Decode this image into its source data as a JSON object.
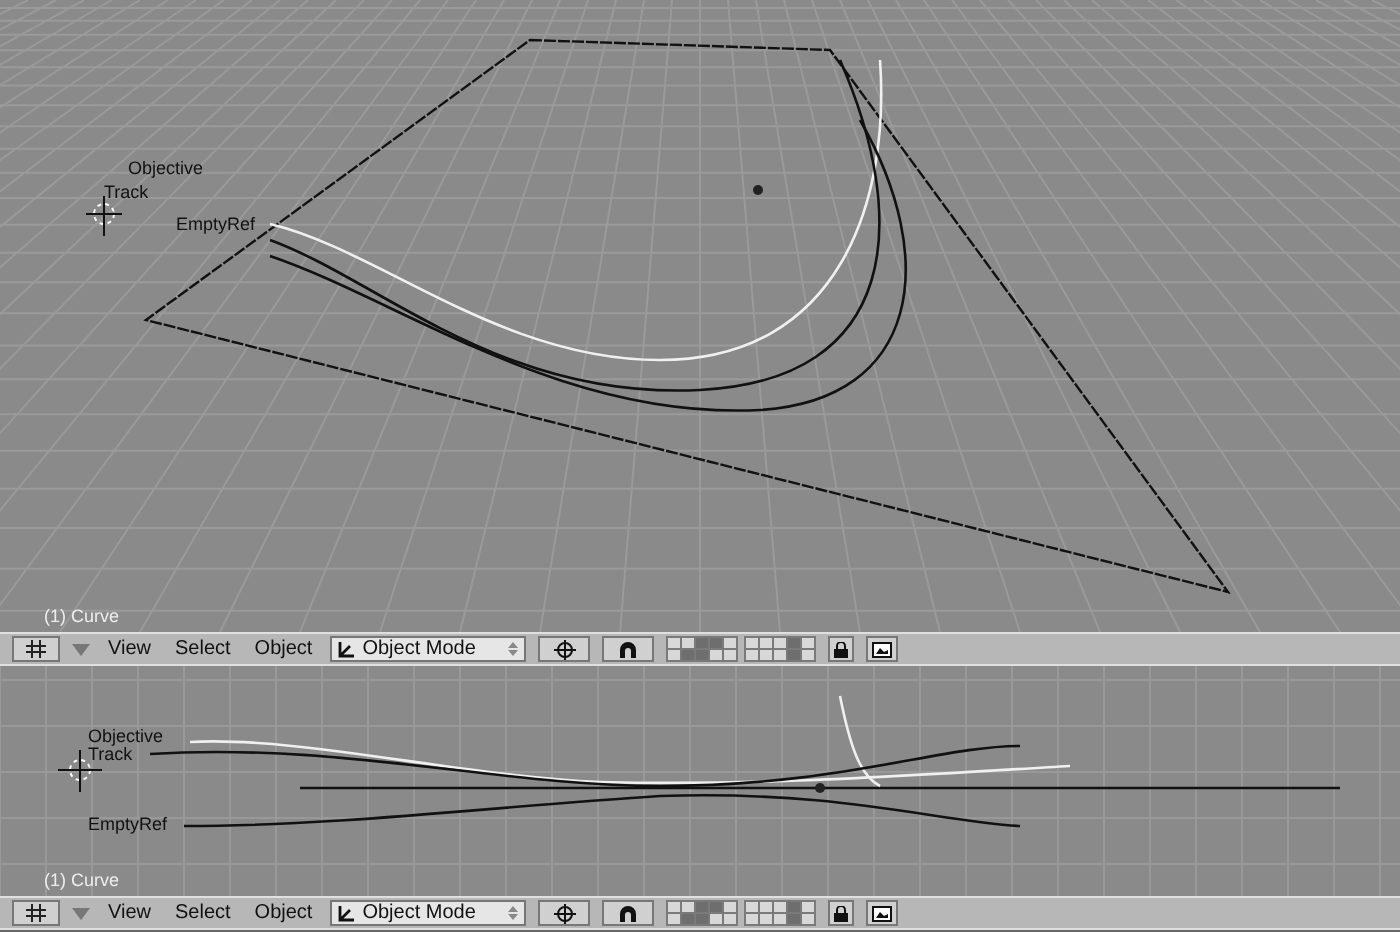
{
  "viewports": [
    {
      "kind": "perspective",
      "objects": [
        "Objective",
        "Track",
        "EmptyRef"
      ],
      "info": "(1) Curve",
      "header": {
        "menus": [
          "View",
          "Select",
          "Object"
        ],
        "mode": "Object Mode",
        "locked": true,
        "layers": [
          {
            "on": false
          },
          {
            "on": false
          },
          {
            "on": true
          },
          {
            "on": true
          },
          {
            "on": false
          },
          {
            "on": false
          },
          {
            "on": true
          },
          {
            "on": true
          },
          {
            "on": false
          },
          {
            "on": false
          },
          {
            "on": false
          },
          {
            "on": false
          },
          {
            "on": false
          },
          {
            "on": true
          },
          {
            "on": false
          },
          {
            "on": false
          },
          {
            "on": false
          },
          {
            "on": false
          },
          {
            "on": true
          },
          {
            "on": false
          }
        ]
      }
    },
    {
      "kind": "front",
      "objects": [
        "Objective",
        "Track",
        "EmptyRef"
      ],
      "info": "(1) Curve",
      "header": {
        "menus": [
          "View",
          "Select",
          "Object"
        ],
        "mode": "Object Mode",
        "locked": true,
        "layers": [
          {
            "on": false
          },
          {
            "on": false
          },
          {
            "on": true
          },
          {
            "on": true
          },
          {
            "on": false
          },
          {
            "on": false
          },
          {
            "on": true
          },
          {
            "on": true
          },
          {
            "on": false
          },
          {
            "on": false
          },
          {
            "on": false
          },
          {
            "on": false
          },
          {
            "on": false
          },
          {
            "on": true
          },
          {
            "on": false
          },
          {
            "on": false
          },
          {
            "on": false
          },
          {
            "on": false
          },
          {
            "on": true
          },
          {
            "on": false
          }
        ]
      }
    }
  ]
}
